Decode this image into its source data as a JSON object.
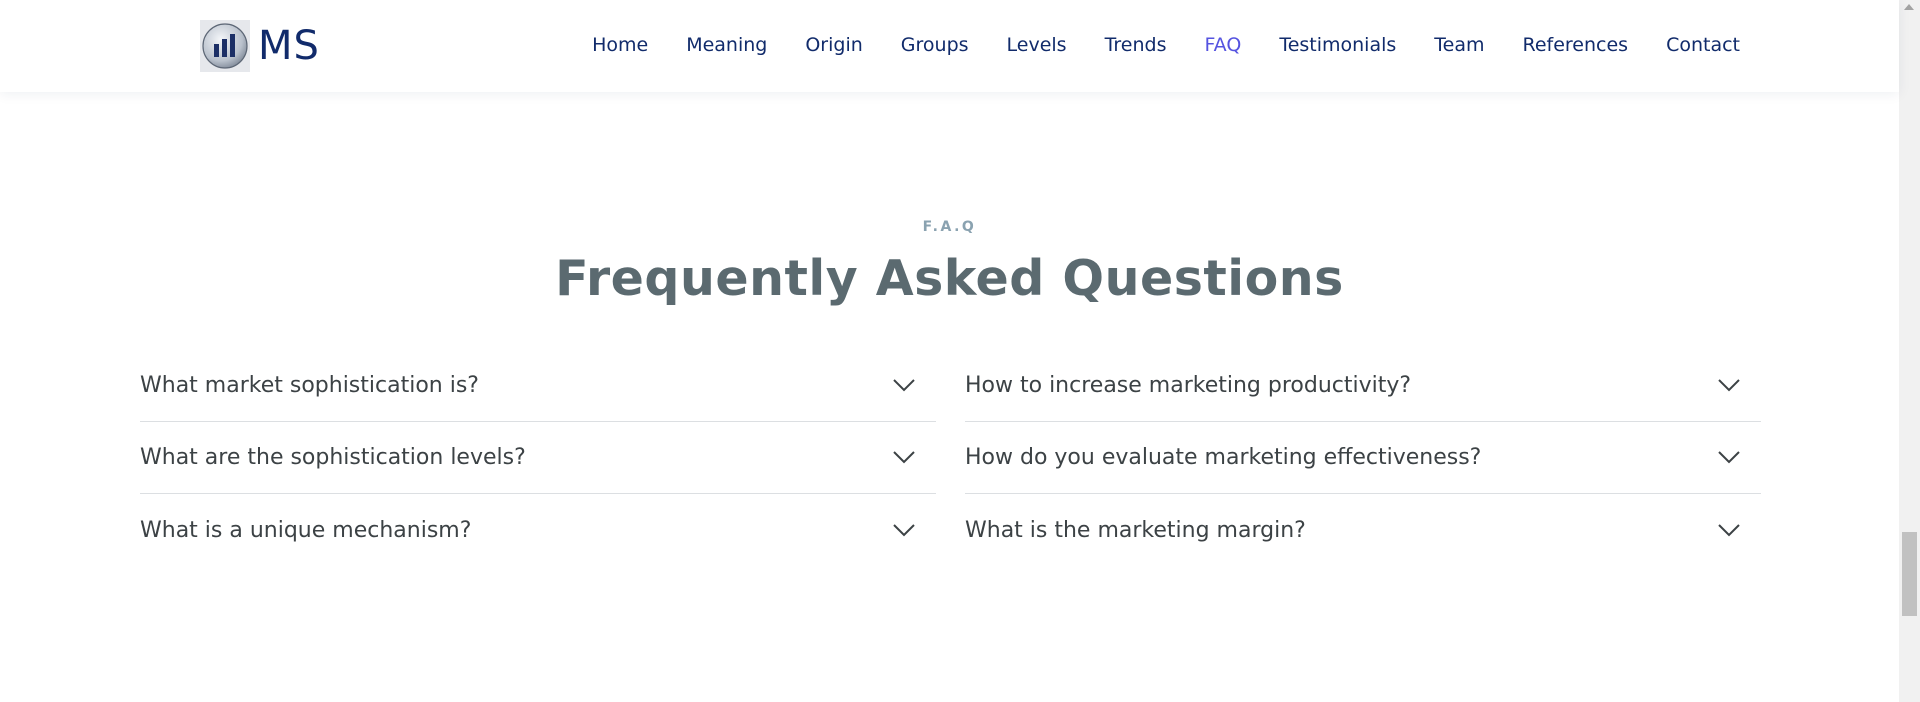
{
  "header": {
    "logo_text": "MS",
    "logo_icon": "bar-chart-icon",
    "nav": [
      {
        "label": "Home"
      },
      {
        "label": "Meaning"
      },
      {
        "label": "Origin"
      },
      {
        "label": "Groups"
      },
      {
        "label": "Levels"
      },
      {
        "label": "Trends"
      },
      {
        "label": "FAQ",
        "active": true
      },
      {
        "label": "Testimonials"
      },
      {
        "label": "Team"
      },
      {
        "label": "References"
      },
      {
        "label": "Contact"
      }
    ],
    "nav_color": "#112b6b",
    "active_color": "#5553e0"
  },
  "faq": {
    "eyebrow": "F.A.Q",
    "title": "Frequently Asked Questions",
    "left": [
      {
        "question": "What market sophistication is?"
      },
      {
        "question": "What are the sophistication levels?"
      },
      {
        "question": "What is a unique mechanism?"
      }
    ],
    "right": [
      {
        "question": "How to increase marketing productivity?"
      },
      {
        "question": "How do you evaluate marketing effectiveness?"
      },
      {
        "question": "What is the marketing margin?"
      }
    ],
    "toggle_icon": "chevron-down-icon"
  }
}
